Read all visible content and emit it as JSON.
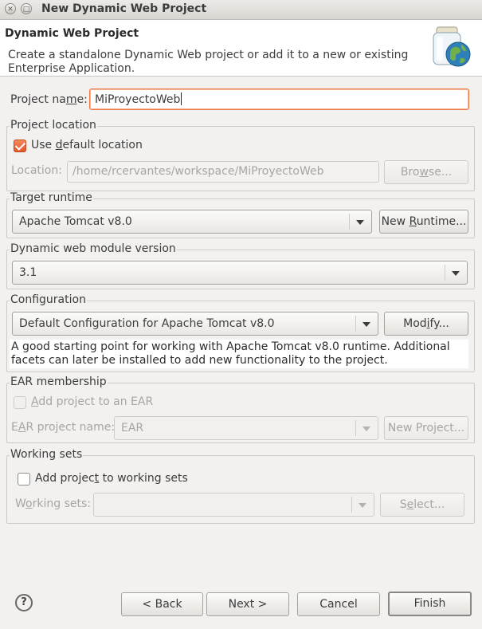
{
  "window": {
    "title": "New Dynamic Web Project"
  },
  "banner": {
    "title": "Dynamic Web Project",
    "description": "Create a standalone Dynamic Web project or add it to a new or existing Enterprise Application."
  },
  "project_name": {
    "label_pre": "Project na",
    "label_mn": "m",
    "label_post": "e:",
    "value": "MiProyectoWeb"
  },
  "project_location": {
    "group_label": "Project location",
    "use_default": {
      "pre": "Use ",
      "mn": "d",
      "post": "efault location",
      "checked": true
    },
    "location_label": "Location:",
    "location_value": "/home/rcervantes/workspace/MiProyectoWeb",
    "browse_button": {
      "pre": "Bro",
      "mn": "w",
      "post": "se..."
    }
  },
  "target_runtime": {
    "group_label": "Target runtime",
    "selected": "Apache Tomcat v8.0",
    "new_runtime_button": {
      "pre": "New ",
      "mn": "R",
      "post": "untime..."
    }
  },
  "module_version": {
    "group_label": "Dynamic web module version",
    "selected": "3.1"
  },
  "configuration": {
    "group_label": "Configuration",
    "selected": "Default Configuration for Apache Tomcat v8.0",
    "modify_button": {
      "pre": "Mod",
      "mn": "i",
      "post": "fy..."
    },
    "description": "A good starting point for working with Apache Tomcat v8.0 runtime. Additional facets can later be installed to add new functionality to the project."
  },
  "ear": {
    "group_label": "EAR membership",
    "add_to_ear": {
      "pre": "",
      "mn": "A",
      "post": "dd project to an EAR",
      "checked": false
    },
    "project_name_label": {
      "pre": "E",
      "mn": "A",
      "post": "R project name:"
    },
    "project_name_value": "EAR",
    "new_project_button": {
      "pre": "New Pro",
      "mn": "j",
      "post": "ect..."
    }
  },
  "working_sets": {
    "group_label": "Working sets",
    "add_to_sets": {
      "pre": "Add projec",
      "mn": "t",
      "post": " to working sets",
      "checked": false
    },
    "sets_label": {
      "pre": "W",
      "mn": "o",
      "post": "rking sets:"
    },
    "select_button": {
      "pre": "S",
      "mn": "e",
      "post": "lect..."
    }
  },
  "footer": {
    "help_symbol": "?",
    "back_label": "< Back",
    "next_label": "Next >",
    "cancel_label": "Cancel",
    "finish_label": "Finish"
  },
  "colors": {
    "accent": "#f07746",
    "checkbox_checked": "#e0582a",
    "window_bg": "#f2f1f0"
  }
}
